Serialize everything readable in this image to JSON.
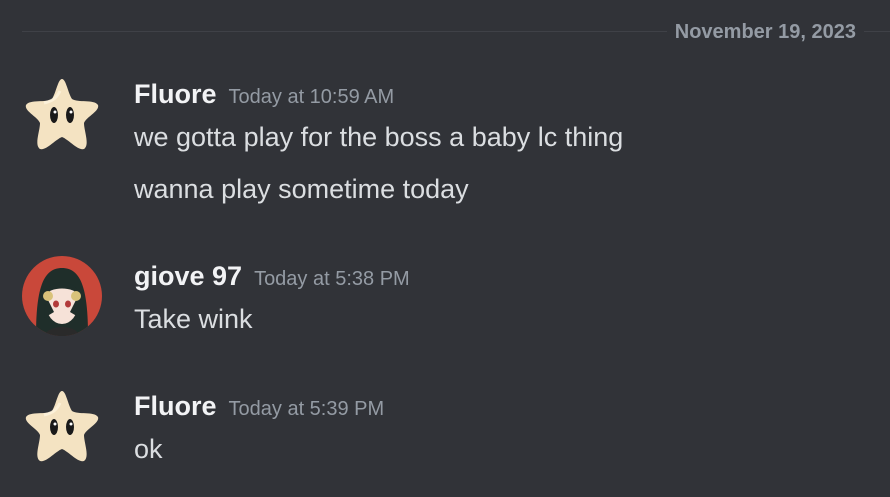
{
  "date_divider": "November 19, 2023",
  "messages": [
    {
      "username": "Fluore",
      "timestamp": "Today at 10:59 AM",
      "avatar_icon": "luma-star-icon",
      "lines": [
        "we gotta play for the boss a baby lc thing",
        "wanna play sometime today"
      ]
    },
    {
      "username": "giove 97",
      "timestamp": "Today at 5:38 PM",
      "avatar_icon": "anime-girl-avatar-icon",
      "lines": [
        "Take wink"
      ]
    },
    {
      "username": "Fluore",
      "timestamp": "Today at 5:39 PM",
      "avatar_icon": "luma-star-icon",
      "lines": [
        "ok"
      ]
    }
  ],
  "colors": {
    "background": "#313338",
    "username": "#f2f3f5",
    "message_text": "#dbdee1",
    "muted": "#949ba4",
    "divider": "#3f4147"
  }
}
